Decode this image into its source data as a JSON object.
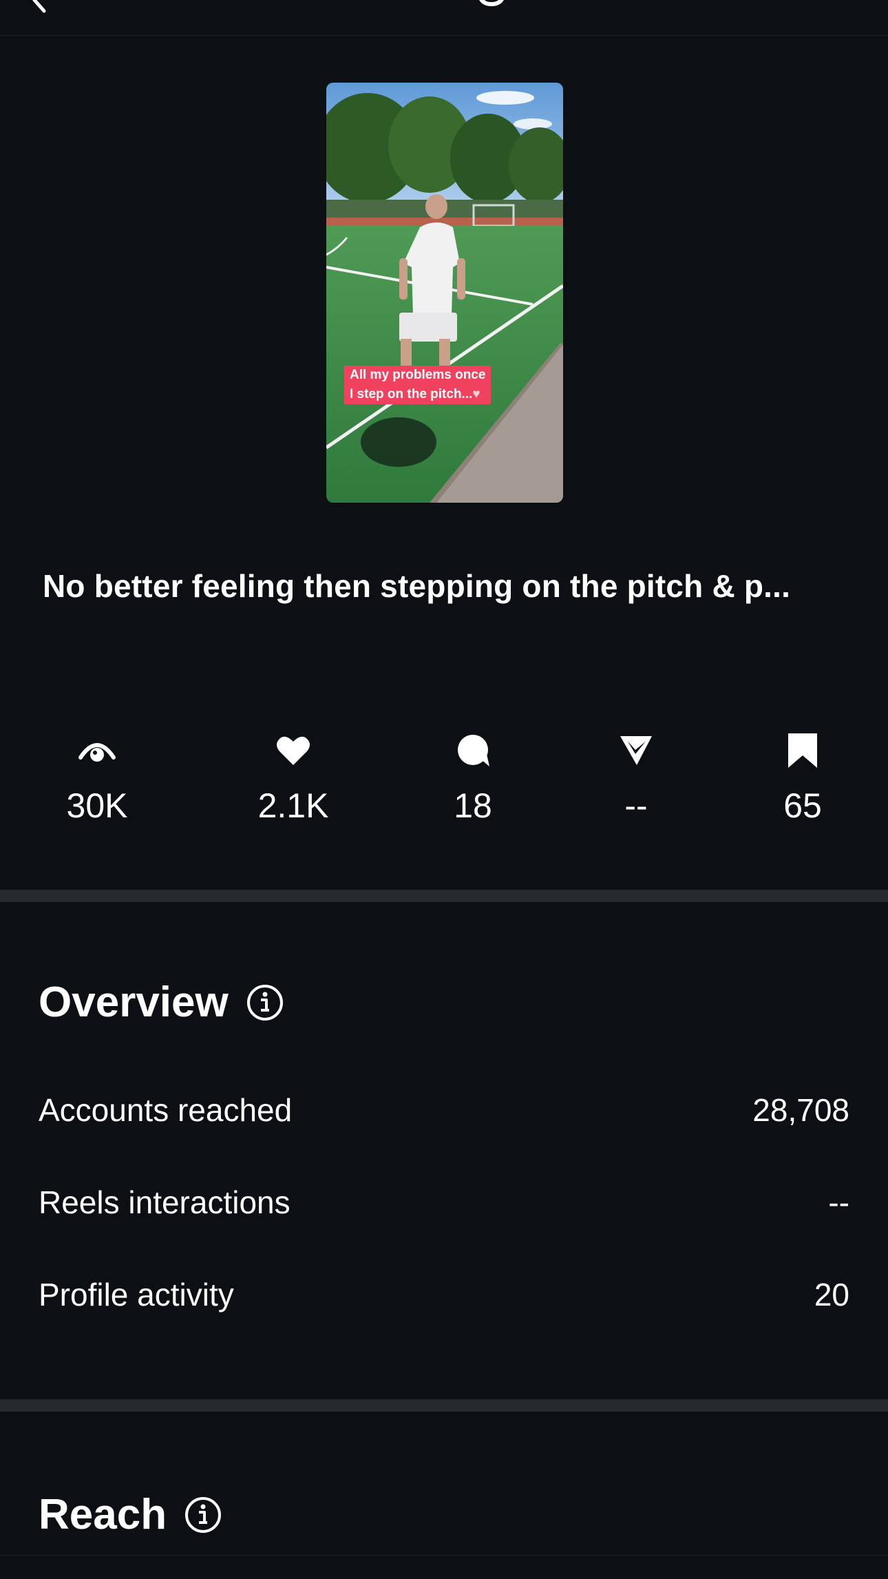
{
  "reel": {
    "thumbnail_caption_line1": "All my problems once",
    "thumbnail_caption_line2": "I step on the pitch...",
    "caption": "No better feeling then stepping on the pitch & p..."
  },
  "stats": [
    {
      "icon": "eye-icon",
      "value": "30K"
    },
    {
      "icon": "heart-icon",
      "value": "2.1K"
    },
    {
      "icon": "comment-icon",
      "value": "18"
    },
    {
      "icon": "share-icon",
      "value": "--"
    },
    {
      "icon": "bookmark-icon",
      "value": "65"
    }
  ],
  "overview": {
    "title": "Overview",
    "rows": [
      {
        "label": "Accounts reached",
        "value": "28,708"
      },
      {
        "label": "Reels interactions",
        "value": "--"
      },
      {
        "label": "Profile activity",
        "value": "20"
      }
    ]
  },
  "reach": {
    "title": "Reach"
  },
  "colors": {
    "background": "#0c1014",
    "divider": "#262a2f",
    "caption_sticker": "#f0425e"
  }
}
